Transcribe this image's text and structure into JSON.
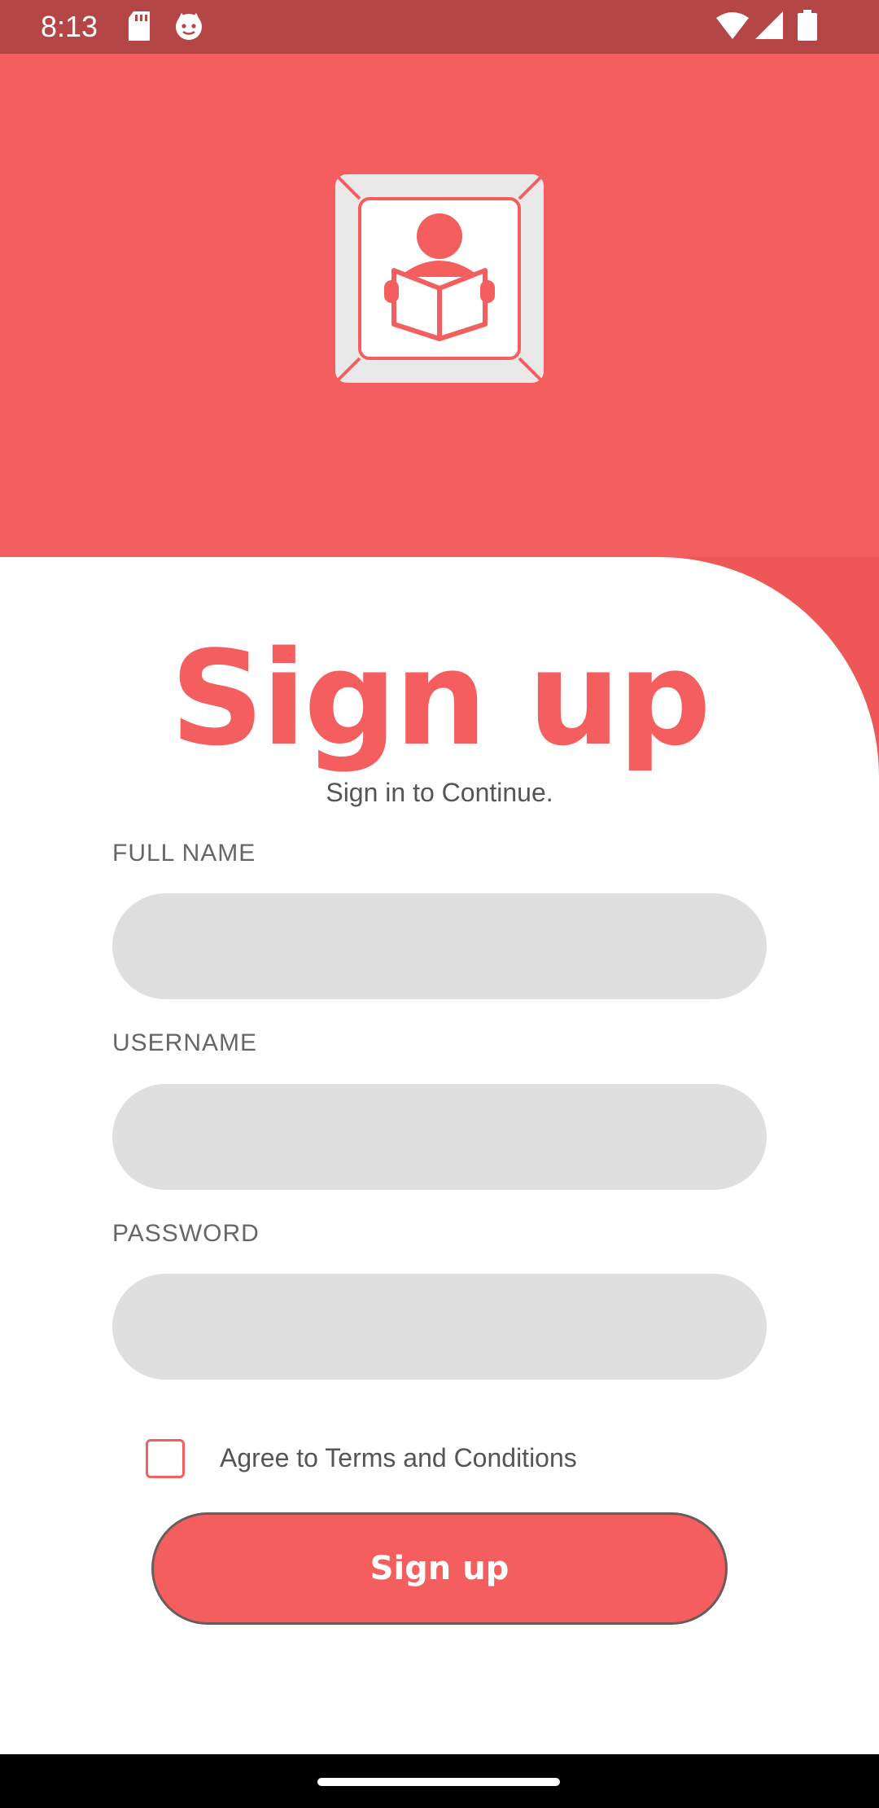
{
  "status_bar": {
    "time": "8:13",
    "left_icons": [
      "sd-card-icon",
      "cat-face-icon"
    ],
    "right_icons": [
      "wifi-icon",
      "signal-icon",
      "battery-icon"
    ]
  },
  "header": {
    "logo_icon": "person-reading-book-icon"
  },
  "form": {
    "title": "Sign up",
    "subtitle": "Sign in to Continue.",
    "fields": [
      {
        "label": "FULL NAME",
        "value": ""
      },
      {
        "label": "USERNAME",
        "value": ""
      },
      {
        "label": "PASSWORD",
        "value": ""
      }
    ],
    "terms_label": "Agree to Terms and Conditions",
    "terms_checked": false,
    "submit_label": "Sign up"
  },
  "colors": {
    "accent": "#f45e5e",
    "status_bar": "#b54646",
    "input_bg": "#dfdfdf"
  }
}
